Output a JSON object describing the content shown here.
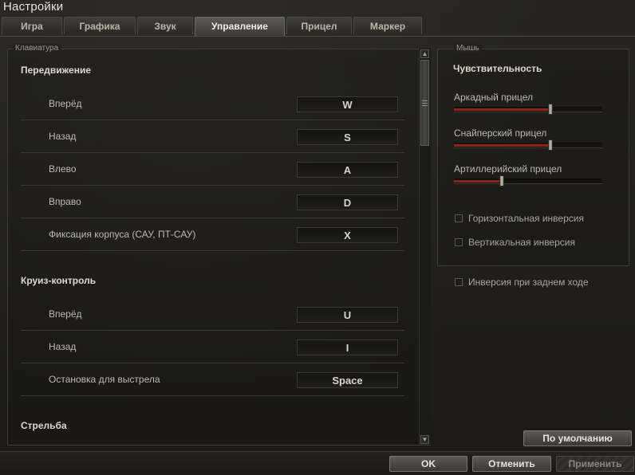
{
  "window": {
    "title": "Настройки"
  },
  "tabs": [
    {
      "label": "Игра",
      "active": false
    },
    {
      "label": "Графика",
      "active": false
    },
    {
      "label": "Звук",
      "active": false
    },
    {
      "label": "Управление",
      "active": true
    },
    {
      "label": "Прицел",
      "active": false
    },
    {
      "label": "Маркер",
      "active": false
    }
  ],
  "keyboard": {
    "legend": "Клавиатура",
    "sections": [
      {
        "title": "Передвижение",
        "rows": [
          {
            "label": "Вперёд",
            "key": "W"
          },
          {
            "label": "Назад",
            "key": "S"
          },
          {
            "label": "Влево",
            "key": "A"
          },
          {
            "label": "Вправо",
            "key": "D"
          },
          {
            "label": "Фиксация корпуса (САУ, ПТ-САУ)",
            "key": "X"
          }
        ]
      },
      {
        "title": "Круиз-контроль",
        "rows": [
          {
            "label": "Вперёд",
            "key": "U"
          },
          {
            "label": "Назад",
            "key": "I"
          },
          {
            "label": "Остановка для выстрела",
            "key": "Space"
          }
        ]
      },
      {
        "title": "Стрельба",
        "rows": []
      }
    ],
    "scroll_up_icon": "▲",
    "scroll_down_icon": "▼"
  },
  "mouse": {
    "legend": "Мышь",
    "sensitivity_title": "Чувствительность",
    "sliders": [
      {
        "label": "Аркадный прицел",
        "value": 0.65
      },
      {
        "label": "Снайперский прицел",
        "value": 0.65
      },
      {
        "label": "Артиллерийский прицел",
        "value": 0.32
      }
    ],
    "checks": [
      {
        "label": "Горизонтальная инверсия",
        "checked": false
      },
      {
        "label": "Вертикальная инверсия",
        "checked": false
      }
    ]
  },
  "reverse_check": {
    "label": "Инверсия при заднем ходе",
    "checked": false
  },
  "buttons": {
    "defaults": "По умолчанию",
    "ok": "OK",
    "cancel": "Отменить",
    "apply": "Применить"
  },
  "colors": {
    "slider_fill": "#8a231c",
    "active_tab": "#5b5a55"
  }
}
